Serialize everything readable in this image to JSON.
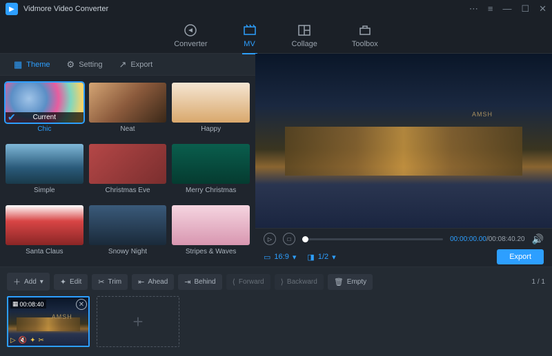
{
  "app": {
    "title": "Vidmore Video Converter"
  },
  "mainnav": [
    {
      "key": "converter",
      "label": "Converter"
    },
    {
      "key": "mv",
      "label": "MV"
    },
    {
      "key": "collage",
      "label": "Collage"
    },
    {
      "key": "toolbox",
      "label": "Toolbox"
    }
  ],
  "subtabs": [
    {
      "key": "theme",
      "label": "Theme"
    },
    {
      "key": "setting",
      "label": "Setting"
    },
    {
      "key": "export",
      "label": "Export"
    }
  ],
  "currentLabel": "Current",
  "themes": [
    {
      "name": "Chic",
      "selected": true
    },
    {
      "name": "Neat"
    },
    {
      "name": "Happy"
    },
    {
      "name": "Simple"
    },
    {
      "name": "Christmas Eve"
    },
    {
      "name": "Merry Christmas"
    },
    {
      "name": "Santa Claus"
    },
    {
      "name": "Snowy Night"
    },
    {
      "name": "Stripes & Waves"
    }
  ],
  "player": {
    "current": "00:00:00.00",
    "duration": "00:08:40.20",
    "aspect": "16:9",
    "split": "1/2",
    "exportLabel": "Export"
  },
  "clipbar": {
    "add": "Add",
    "edit": "Edit",
    "trim": "Trim",
    "ahead": "Ahead",
    "behind": "Behind",
    "forward": "Forward",
    "backward": "Backward",
    "empty": "Empty",
    "page": "1 / 1"
  },
  "clip": {
    "duration": "00:08:40"
  }
}
